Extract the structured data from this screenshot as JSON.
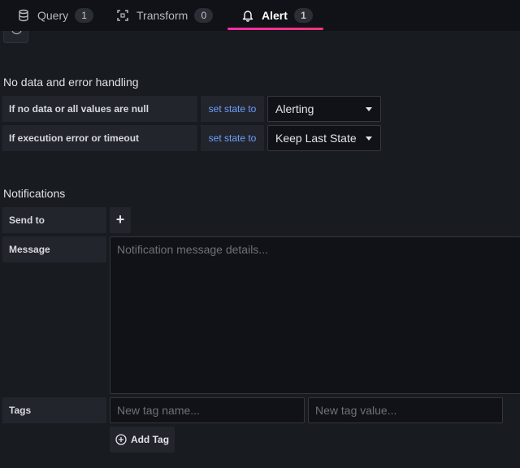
{
  "tabs": [
    {
      "label": "Query",
      "count": "1",
      "icon": "database-icon"
    },
    {
      "label": "Transform",
      "count": "0",
      "icon": "transform-icon"
    },
    {
      "label": "Alert",
      "count": "1",
      "icon": "bell-icon",
      "active": true
    }
  ],
  "accent_color": "#ff2ea6",
  "no_data": {
    "title": "No data and error handling",
    "rows": [
      {
        "label": "If no data or all values are null",
        "link": "set state to",
        "value": "Alerting"
      },
      {
        "label": "If execution error or timeout",
        "link": "set state to",
        "value": "Keep Last State"
      }
    ]
  },
  "notifications": {
    "title": "Notifications",
    "send_to_label": "Send to",
    "add_symbol": "+",
    "message_label": "Message",
    "message_placeholder": "Notification message details...",
    "tags_label": "Tags",
    "tag_name_placeholder": "New tag name...",
    "tag_value_placeholder": "New tag value...",
    "add_tag_label": "Add Tag"
  }
}
